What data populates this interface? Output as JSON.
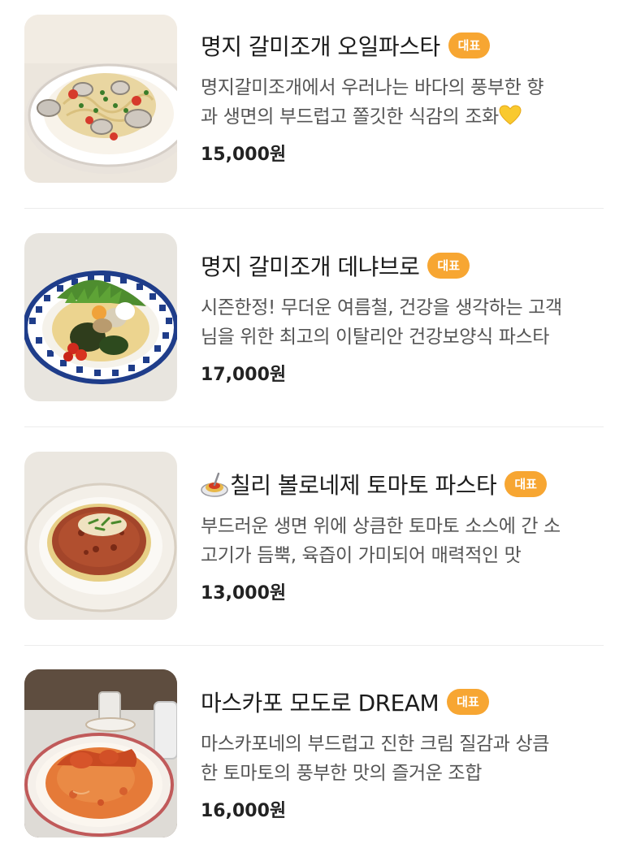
{
  "items": [
    {
      "name": "명지 갈미조개 오일파스타",
      "badge": "대표",
      "desc_line1": "명지갈미조개에서 우러나는 바다의 풍부한 향",
      "desc_line2": "과 생면의 부드럽고 쫄깃한 식감의 조화",
      "price": "15,000원"
    },
    {
      "name": "명지 갈미조개 데냐브로",
      "badge": "대표",
      "desc_line1": "시즌한정! 무더운 여름철, 건강을 생각하는 고객",
      "desc_line2": "님을 위한 최고의 이탈리안 건강보양식 파스타",
      "price": "17,000원"
    },
    {
      "name": "칠리 볼로네제 토마토 파스타",
      "badge": "대표",
      "desc_line1": "부드러운 생면 위에 상큼한 토마토 소스에 간 소",
      "desc_line2": "고기가 듬뿍, 육즙이 가미되어 매력적인 맛",
      "price": "13,000원"
    },
    {
      "name": "마스카포 모도로 DREAM",
      "badge": "대표",
      "desc_line1": "마스카포네의 부드럽고 진한 크림 질감과 상큼",
      "desc_line2": "한 토마토의 풍부한 맛의 즐거운 조합",
      "price": "16,000원"
    }
  ],
  "icons": {
    "yellow_heart": "yellow-heart-emoji",
    "spaghetti": "spaghetti-emoji"
  },
  "colors": {
    "badge": "#f7a632",
    "text": "#1b1b1b",
    "desc": "#555555",
    "divider": "#ececec"
  }
}
